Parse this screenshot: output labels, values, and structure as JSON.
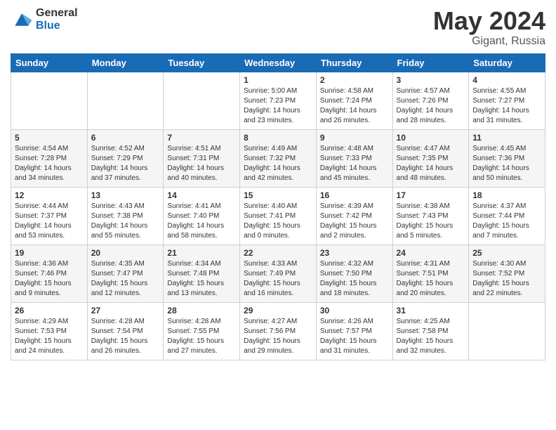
{
  "header": {
    "logo_general": "General",
    "logo_blue": "Blue",
    "month": "May 2024",
    "location": "Gigant, Russia"
  },
  "days_of_week": [
    "Sunday",
    "Monday",
    "Tuesday",
    "Wednesday",
    "Thursday",
    "Friday",
    "Saturday"
  ],
  "weeks": [
    [
      {
        "day": "",
        "info": ""
      },
      {
        "day": "",
        "info": ""
      },
      {
        "day": "",
        "info": ""
      },
      {
        "day": "1",
        "info": "Sunrise: 5:00 AM\nSunset: 7:23 PM\nDaylight: 14 hours\nand 23 minutes."
      },
      {
        "day": "2",
        "info": "Sunrise: 4:58 AM\nSunset: 7:24 PM\nDaylight: 14 hours\nand 26 minutes."
      },
      {
        "day": "3",
        "info": "Sunrise: 4:57 AM\nSunset: 7:26 PM\nDaylight: 14 hours\nand 28 minutes."
      },
      {
        "day": "4",
        "info": "Sunrise: 4:55 AM\nSunset: 7:27 PM\nDaylight: 14 hours\nand 31 minutes."
      }
    ],
    [
      {
        "day": "5",
        "info": "Sunrise: 4:54 AM\nSunset: 7:28 PM\nDaylight: 14 hours\nand 34 minutes."
      },
      {
        "day": "6",
        "info": "Sunrise: 4:52 AM\nSunset: 7:29 PM\nDaylight: 14 hours\nand 37 minutes."
      },
      {
        "day": "7",
        "info": "Sunrise: 4:51 AM\nSunset: 7:31 PM\nDaylight: 14 hours\nand 40 minutes."
      },
      {
        "day": "8",
        "info": "Sunrise: 4:49 AM\nSunset: 7:32 PM\nDaylight: 14 hours\nand 42 minutes."
      },
      {
        "day": "9",
        "info": "Sunrise: 4:48 AM\nSunset: 7:33 PM\nDaylight: 14 hours\nand 45 minutes."
      },
      {
        "day": "10",
        "info": "Sunrise: 4:47 AM\nSunset: 7:35 PM\nDaylight: 14 hours\nand 48 minutes."
      },
      {
        "day": "11",
        "info": "Sunrise: 4:45 AM\nSunset: 7:36 PM\nDaylight: 14 hours\nand 50 minutes."
      }
    ],
    [
      {
        "day": "12",
        "info": "Sunrise: 4:44 AM\nSunset: 7:37 PM\nDaylight: 14 hours\nand 53 minutes."
      },
      {
        "day": "13",
        "info": "Sunrise: 4:43 AM\nSunset: 7:38 PM\nDaylight: 14 hours\nand 55 minutes."
      },
      {
        "day": "14",
        "info": "Sunrise: 4:41 AM\nSunset: 7:40 PM\nDaylight: 14 hours\nand 58 minutes."
      },
      {
        "day": "15",
        "info": "Sunrise: 4:40 AM\nSunset: 7:41 PM\nDaylight: 15 hours\nand 0 minutes."
      },
      {
        "day": "16",
        "info": "Sunrise: 4:39 AM\nSunset: 7:42 PM\nDaylight: 15 hours\nand 2 minutes."
      },
      {
        "day": "17",
        "info": "Sunrise: 4:38 AM\nSunset: 7:43 PM\nDaylight: 15 hours\nand 5 minutes."
      },
      {
        "day": "18",
        "info": "Sunrise: 4:37 AM\nSunset: 7:44 PM\nDaylight: 15 hours\nand 7 minutes."
      }
    ],
    [
      {
        "day": "19",
        "info": "Sunrise: 4:36 AM\nSunset: 7:46 PM\nDaylight: 15 hours\nand 9 minutes."
      },
      {
        "day": "20",
        "info": "Sunrise: 4:35 AM\nSunset: 7:47 PM\nDaylight: 15 hours\nand 12 minutes."
      },
      {
        "day": "21",
        "info": "Sunrise: 4:34 AM\nSunset: 7:48 PM\nDaylight: 15 hours\nand 13 minutes."
      },
      {
        "day": "22",
        "info": "Sunrise: 4:33 AM\nSunset: 7:49 PM\nDaylight: 15 hours\nand 16 minutes."
      },
      {
        "day": "23",
        "info": "Sunrise: 4:32 AM\nSunset: 7:50 PM\nDaylight: 15 hours\nand 18 minutes."
      },
      {
        "day": "24",
        "info": "Sunrise: 4:31 AM\nSunset: 7:51 PM\nDaylight: 15 hours\nand 20 minutes."
      },
      {
        "day": "25",
        "info": "Sunrise: 4:30 AM\nSunset: 7:52 PM\nDaylight: 15 hours\nand 22 minutes."
      }
    ],
    [
      {
        "day": "26",
        "info": "Sunrise: 4:29 AM\nSunset: 7:53 PM\nDaylight: 15 hours\nand 24 minutes."
      },
      {
        "day": "27",
        "info": "Sunrise: 4:28 AM\nSunset: 7:54 PM\nDaylight: 15 hours\nand 26 minutes."
      },
      {
        "day": "28",
        "info": "Sunrise: 4:28 AM\nSunset: 7:55 PM\nDaylight: 15 hours\nand 27 minutes."
      },
      {
        "day": "29",
        "info": "Sunrise: 4:27 AM\nSunset: 7:56 PM\nDaylight: 15 hours\nand 29 minutes."
      },
      {
        "day": "30",
        "info": "Sunrise: 4:26 AM\nSunset: 7:57 PM\nDaylight: 15 hours\nand 31 minutes."
      },
      {
        "day": "31",
        "info": "Sunrise: 4:25 AM\nSunset: 7:58 PM\nDaylight: 15 hours\nand 32 minutes."
      },
      {
        "day": "",
        "info": ""
      }
    ]
  ]
}
